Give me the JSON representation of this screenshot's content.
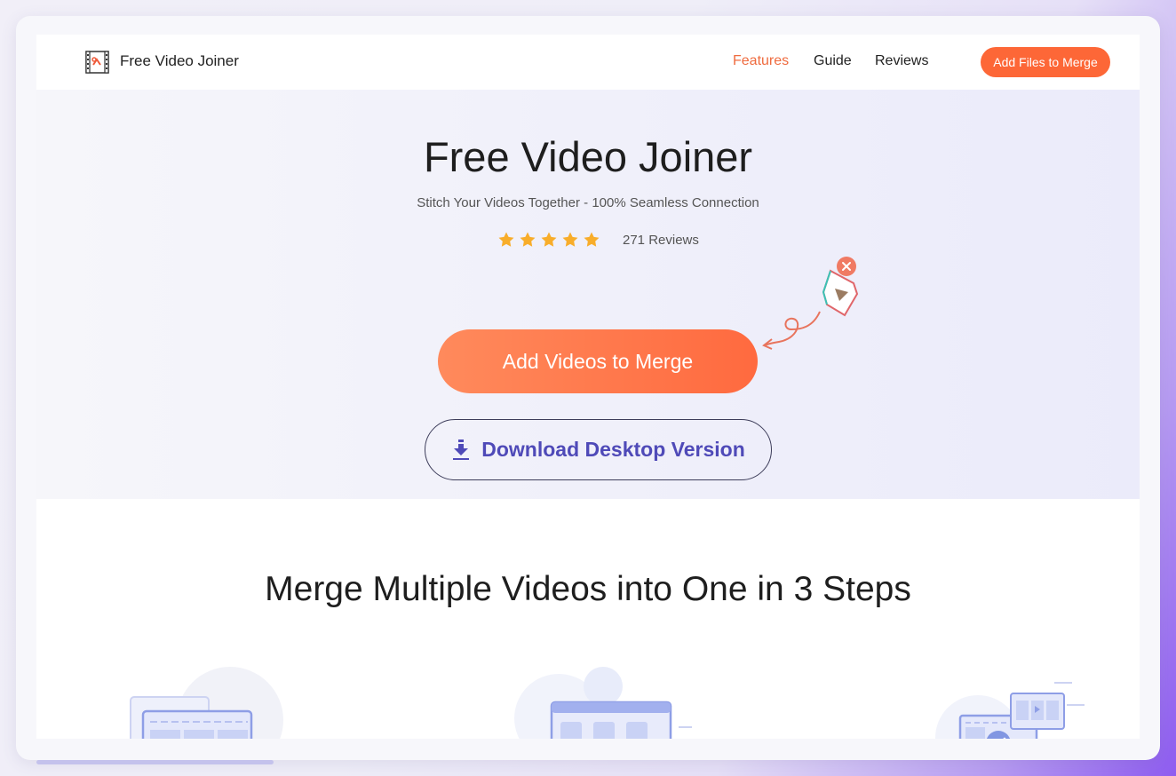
{
  "header": {
    "brand": "Free Video Joiner",
    "nav": [
      {
        "label": "Features",
        "active": true
      },
      {
        "label": "Guide",
        "active": false
      },
      {
        "label": "Reviews",
        "active": false
      }
    ],
    "cta_label": "Add Files to Merge"
  },
  "hero": {
    "title": "Free Video Joiner",
    "subtitle": "Stitch Your Videos Together - 100% Seamless Connection",
    "rating_stars": 5,
    "reviews_text": "271 Reviews",
    "primary_button": "Add Videos to Merge",
    "download_button": "Download Desktop Version"
  },
  "steps": {
    "title": "Merge Multiple Videos into One in 3 Steps"
  },
  "colors": {
    "accent_orange": "#fd6737",
    "star": "#f8ad2a",
    "download_text": "#4f4ab8",
    "illustration_blue": "#8e9ee6"
  },
  "icons": [
    "film-logo-icon",
    "star-icon",
    "download-icon",
    "video-file-icon",
    "close-icon",
    "curved-arrow-icon"
  ]
}
